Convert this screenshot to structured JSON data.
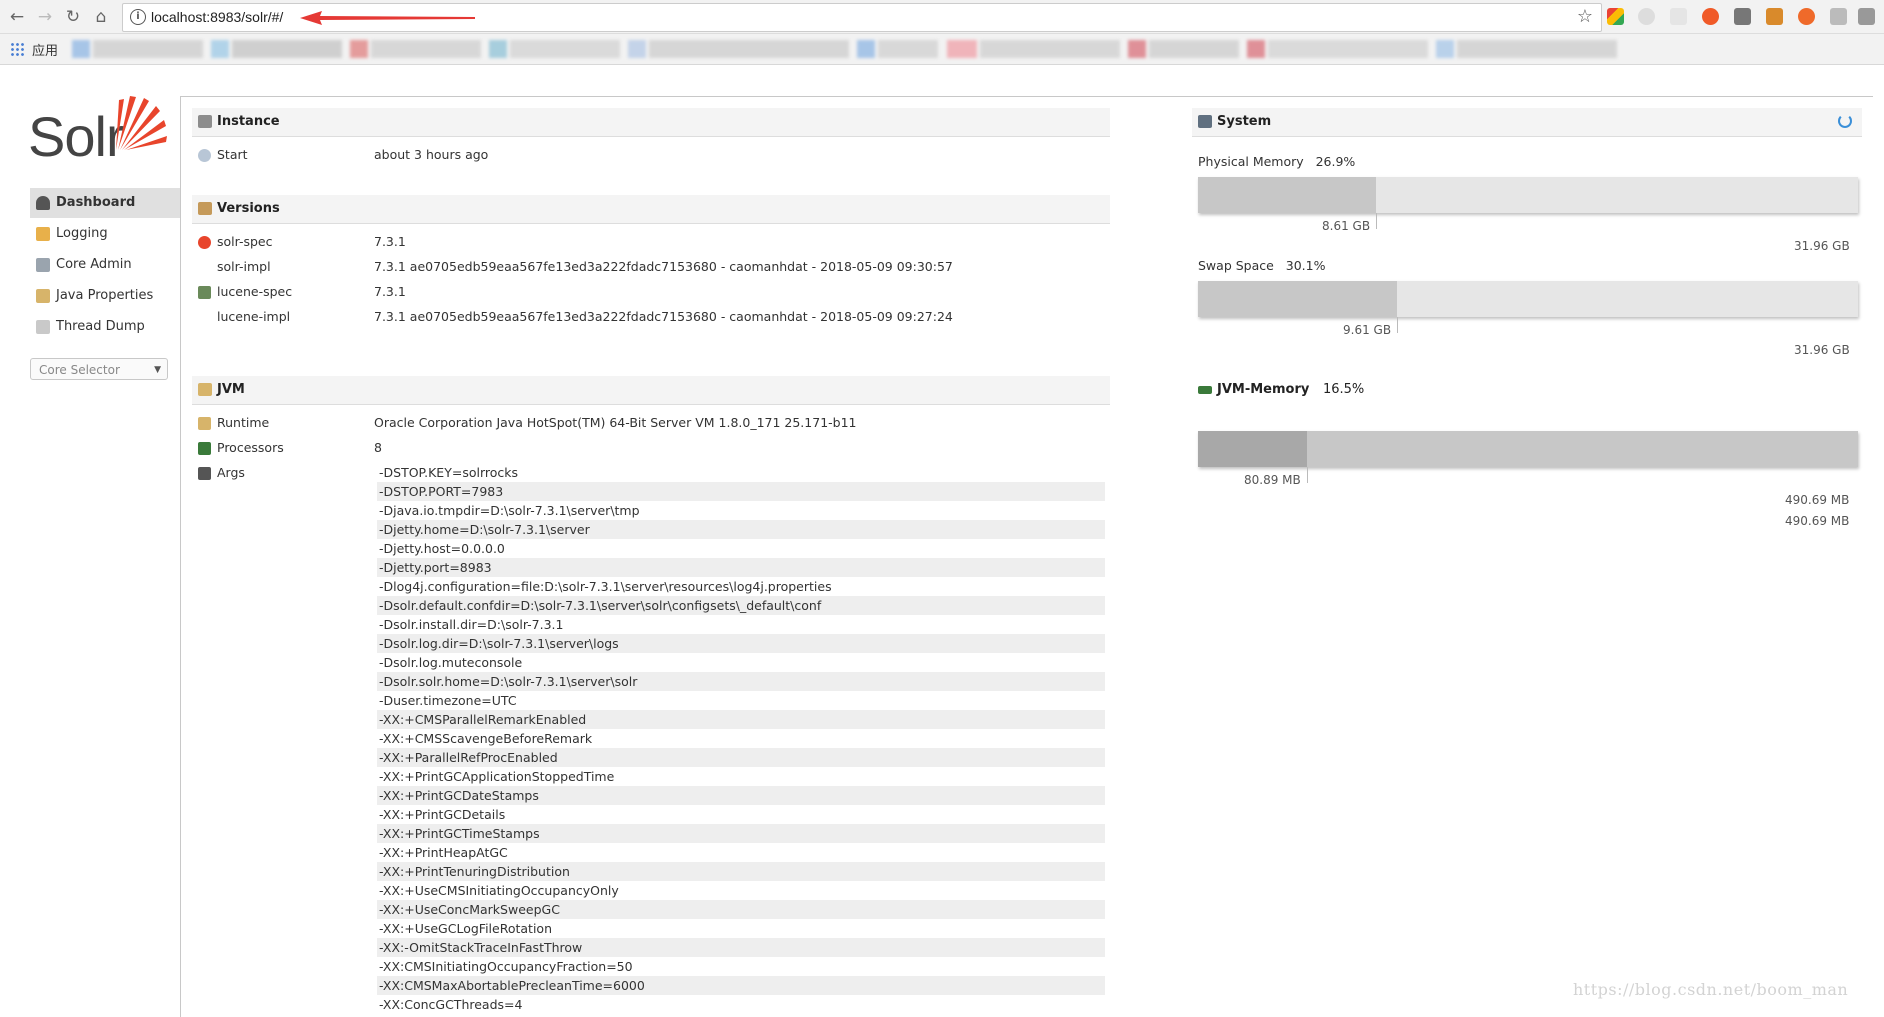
{
  "browser": {
    "url": "localhost:8983/solr/#/",
    "bookmarks_label": "应用"
  },
  "logo": {
    "text": "Solr"
  },
  "nav": {
    "items": [
      {
        "label": "Dashboard"
      },
      {
        "label": "Logging"
      },
      {
        "label": "Core Admin"
      },
      {
        "label": "Java Properties"
      },
      {
        "label": "Thread Dump"
      }
    ],
    "core_selector": "Core Selector"
  },
  "instance": {
    "title": "Instance",
    "start_label": "Start",
    "start_value": "about 3 hours ago"
  },
  "versions": {
    "title": "Versions",
    "rows": [
      {
        "key": "solr-spec",
        "value": "7.3.1"
      },
      {
        "key": "solr-impl",
        "value": "7.3.1 ae0705edb59eaa567fe13ed3a222fdadc7153680 - caomanhdat - 2018-05-09 09:30:57"
      },
      {
        "key": "lucene-spec",
        "value": "7.3.1"
      },
      {
        "key": "lucene-impl",
        "value": "7.3.1 ae0705edb59eaa567fe13ed3a222fdadc7153680 - caomanhdat - 2018-05-09 09:27:24"
      }
    ]
  },
  "jvm": {
    "title": "JVM",
    "runtime_label": "Runtime",
    "runtime_value": "Oracle Corporation Java HotSpot(TM) 64-Bit Server VM 1.8.0_171 25.171-b11",
    "processors_label": "Processors",
    "processors_value": "8",
    "args_label": "Args",
    "args": [
      "-DSTOP.KEY=solrrocks",
      "-DSTOP.PORT=7983",
      "-Djava.io.tmpdir=D:\\solr-7.3.1\\server\\tmp",
      "-Djetty.home=D:\\solr-7.3.1\\server",
      "-Djetty.host=0.0.0.0",
      "-Djetty.port=8983",
      "-Dlog4j.configuration=file:D:\\solr-7.3.1\\server\\resources\\log4j.properties",
      "-Dsolr.default.confdir=D:\\solr-7.3.1\\server\\solr\\configsets\\_default\\conf",
      "-Dsolr.install.dir=D:\\solr-7.3.1",
      "-Dsolr.log.dir=D:\\solr-7.3.1\\server\\logs",
      "-Dsolr.log.muteconsole",
      "-Dsolr.solr.home=D:\\solr-7.3.1\\server\\solr",
      "-Duser.timezone=UTC",
      "-XX:+CMSParallelRemarkEnabled",
      "-XX:+CMSScavengeBeforeRemark",
      "-XX:+ParallelRefProcEnabled",
      "-XX:+PrintGCApplicationStoppedTime",
      "-XX:+PrintGCDateStamps",
      "-XX:+PrintGCDetails",
      "-XX:+PrintGCTimeStamps",
      "-XX:+PrintHeapAtGC",
      "-XX:+PrintTenuringDistribution",
      "-XX:+UseCMSInitiatingOccupancyOnly",
      "-XX:+UseConcMarkSweepGC",
      "-XX:+UseGCLogFileRotation",
      "-XX:-OmitStackTraceInFastThrow",
      "-XX:CMSInitiatingOccupancyFraction=50",
      "-XX:CMSMaxAbortablePrecleanTime=6000",
      "-XX:ConcGCThreads=4"
    ]
  },
  "system": {
    "title": "System",
    "physical": {
      "label": "Physical Memory",
      "percent": "26.9%",
      "used": "8.61 GB",
      "total": "31.96 GB",
      "fraction": 0.269
    },
    "swap": {
      "label": "Swap Space",
      "percent": "30.1%",
      "used": "9.61 GB",
      "total": "31.96 GB",
      "fraction": 0.301
    }
  },
  "jvm_memory": {
    "title": "JVM-Memory",
    "percent": "16.5%",
    "used": "80.89 MB",
    "committed": "490.69 MB",
    "max": "490.69 MB",
    "used_fraction": 0.165
  },
  "watermark": "https://blog.csdn.net/boom_man"
}
